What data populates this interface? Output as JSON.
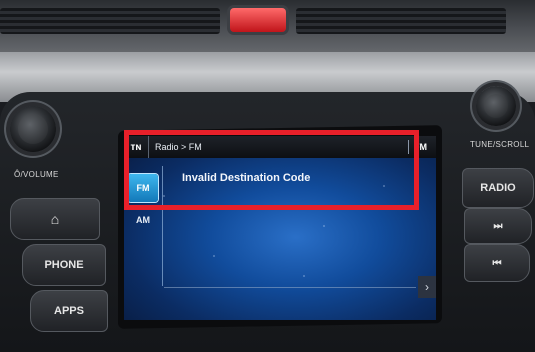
{
  "dashboard": {
    "knob_left_label": "Ô/VOLUME",
    "knob_right_label": "TUNE/SCROLL"
  },
  "left_buttons": [
    {
      "label": "⌂",
      "icon": "home-icon"
    },
    {
      "label": "PHONE"
    },
    {
      "label": "APPS"
    }
  ],
  "right_buttons": [
    {
      "label": "RADIO"
    },
    {
      "label": "⏭",
      "icon": "skip-forward-icon"
    },
    {
      "label": "⏮",
      "icon": "skip-back-icon"
    }
  ],
  "screen": {
    "home_back_label": "ᴛɴ",
    "breadcrumb": "Radio > FM",
    "band_indicator": "FM",
    "tabs": [
      {
        "label": "FM",
        "active": true
      },
      {
        "label": "AM",
        "active": false
      }
    ],
    "message": "Invalid Destination Code",
    "scroll_arrow": "›"
  },
  "annotation": {
    "color": "#e8202a"
  }
}
